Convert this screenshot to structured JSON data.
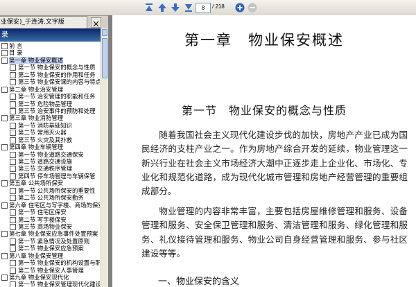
{
  "toolbar": {
    "current_page": "8",
    "total_pages": "/ 218",
    "colors": {
      "nav_arrow": "#3b6cc4",
      "zoom_in": "#2d5fc0",
      "zoom_out": "#b9b9b9"
    },
    "icons": [
      "first-page-icon",
      "previous-page-icon",
      "next-page-icon",
      "last-page-icon",
      "zoom-in-icon",
      "zoom-out-icon"
    ]
  },
  "document_tab": {
    "title": "业保安)_于连涛.文字版"
  },
  "sidebar": {
    "header": "录",
    "items": [
      {
        "label": "前  言",
        "level": 0
      },
      {
        "label": "目  录",
        "level": 0
      },
      {
        "label": "第一章  物业保安概述",
        "level": 0,
        "selected": true
      },
      {
        "label": "第一节  物业保安的概念与性质",
        "level": 1
      },
      {
        "label": "第二节  物业保安的作用和任务",
        "level": 1
      },
      {
        "label": "第三节  物业保安课的内容与特点",
        "level": 1
      },
      {
        "label": "第二章  物业治安管理",
        "level": 0
      },
      {
        "label": "第一节  治安管理的职能和任务",
        "level": 1
      },
      {
        "label": "第二节  危险物品管理",
        "level": 1
      },
      {
        "label": "第三节  治安事件的预防和处理",
        "level": 1
      },
      {
        "label": "第三章  物业消防管理",
        "level": 0
      },
      {
        "label": "第一节  消防基础知识",
        "level": 1
      },
      {
        "label": "第二节  常用灭火器",
        "level": 1
      },
      {
        "label": "第三节  火灾及其扑救",
        "level": 1
      },
      {
        "label": "第四章  物业车辆管理",
        "level": 0
      },
      {
        "label": "第一节  物业道路交通保安",
        "level": 1
      },
      {
        "label": "第二节  道路交通设施",
        "level": 1
      },
      {
        "label": "第三节  交通秩序管理",
        "level": 1
      },
      {
        "label": "第四节  停车场管理与车辆保管",
        "level": 1
      },
      {
        "label": "第五章  公共场所保安",
        "level": 0
      },
      {
        "label": "第一节  公共场所保安的重要性",
        "level": 1
      },
      {
        "label": "第二节  公共场所保安勤务",
        "level": 1
      },
      {
        "label": "第六章  住宅区与写字楼、商场的保安",
        "level": 0
      },
      {
        "label": "第一节  住宅区保安",
        "level": 1
      },
      {
        "label": "第二节  写字楼保安",
        "level": 1
      },
      {
        "label": "第三节  商场物业保安",
        "level": 1
      },
      {
        "label": "第七章  物业保安应急事件处置预案",
        "level": 0
      },
      {
        "label": "第一节  紧急情况及处置原则",
        "level": 1
      },
      {
        "label": "第二节  物业保安应急预案",
        "level": 1
      },
      {
        "label": "第八章  物业保安管理",
        "level": 0
      },
      {
        "label": "第一节  物业保安的机构设置与职责",
        "level": 1
      },
      {
        "label": "第二节  物业保安人事管理",
        "level": 1
      },
      {
        "label": "第九章  物业保安现代化",
        "level": 0
      },
      {
        "label": "第一节  物业保安管理现代化建设",
        "level": 1
      }
    ]
  },
  "page": {
    "chapter_title": "第一章　物业保安概述",
    "section_title": "第一节　物业保安的概念与性质",
    "paragraph1": "随着我国社会主义现代化建设步伐的加快，房地产产业已成为国民经济的支柱产业之一。作为房地产综合开发的延续，物业管理这一新兴行业在社会主义市场经济大潮中正逐步走上企业化、市场化、专业化和规范化道路，成为现代化城市管理和房地产经营管理的重要组成部分。",
    "paragraph2": "物业管理的内容非常丰富，主要包括房屋维修管理和服务、设备管理和服务、安全保卫管理和服务、清洁管理和服务、绿化管理和服务、礼仪接待管理和服务、物业公司自身经营管理和服务、参与社区建设等等。",
    "subheading": "一、物业保安的含义"
  }
}
